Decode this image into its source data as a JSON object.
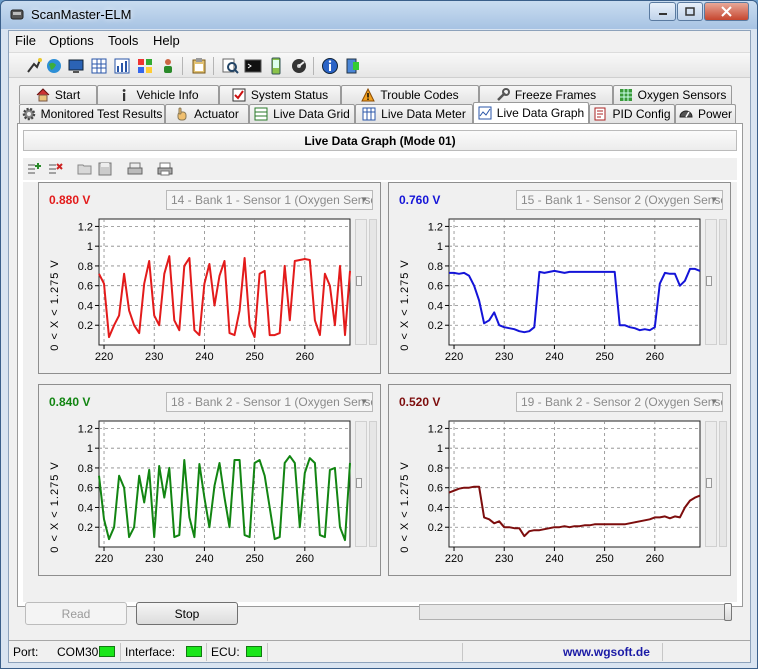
{
  "window": {
    "title": "ScanMaster-ELM"
  },
  "menu": [
    "File",
    "Options",
    "Tools",
    "Help"
  ],
  "tabs_row1": [
    {
      "label": "Start",
      "icon": "house-icon"
    },
    {
      "label": "Vehicle Info",
      "icon": "info-i-icon"
    },
    {
      "label": "System Status",
      "icon": "checkbox-icon"
    },
    {
      "label": "Trouble Codes",
      "icon": "warning-icon"
    },
    {
      "label": "Freeze Frames",
      "icon": "tools-icon"
    },
    {
      "label": "Oxygen Sensors",
      "icon": "grid-icon"
    }
  ],
  "tabs_row2": [
    {
      "label": "Monitored Test Results",
      "icon": "gear-icon"
    },
    {
      "label": "Actuator",
      "icon": "hand-icon"
    },
    {
      "label": "Live Data Grid",
      "icon": "grid-table-icon"
    },
    {
      "label": "Live Data Meter",
      "icon": "meter-icon"
    },
    {
      "label": "Live Data Graph",
      "icon": "graph-icon"
    },
    {
      "label": "PID Config",
      "icon": "config-icon"
    },
    {
      "label": "Power",
      "icon": "gauge-icon"
    }
  ],
  "panel": {
    "title": "Live Data Graph (Mode 01)"
  },
  "graphs": [
    {
      "value": "0.880 V",
      "color": "#e31b1b",
      "sensor": "14 - Bank 1 - Sensor 1 (Oxygen Senso",
      "ylabel": "0  < X <  1.275  V",
      "yticks": [
        "1.2",
        "1",
        "0.8",
        "0.6",
        "0.4",
        "0.2"
      ],
      "xticks": [
        "220",
        "230",
        "240",
        "250",
        "260"
      ]
    },
    {
      "value": "0.760 V",
      "color": "#1414d8",
      "sensor": "15 - Bank 1 - Sensor 2 (Oxygen Senso",
      "ylabel": "0  < X <  1.275  V",
      "yticks": [
        "1.2",
        "1",
        "0.8",
        "0.6",
        "0.4",
        "0.2"
      ],
      "xticks": [
        "220",
        "230",
        "240",
        "250",
        "260"
      ]
    },
    {
      "value": "0.840 V",
      "color": "#128512",
      "sensor": "18 - Bank 2 - Sensor 1 (Oxygen Senso",
      "ylabel": "0  < X <  1.275  V",
      "yticks": [
        "1.2",
        "1",
        "0.8",
        "0.6",
        "0.4",
        "0.2"
      ],
      "xticks": [
        "220",
        "230",
        "240",
        "250",
        "260"
      ]
    },
    {
      "value": "0.520 V",
      "color": "#7d0d0d",
      "sensor": "19 - Bank 2 - Sensor 2 (Oxygen Senso",
      "ylabel": "0  < X <  1.275  V",
      "yticks": [
        "1.2",
        "1",
        "0.8",
        "0.6",
        "0.4",
        "0.2"
      ],
      "xticks": [
        "220",
        "230",
        "240",
        "250",
        "260"
      ]
    }
  ],
  "chart_data": [
    {
      "type": "line",
      "x_start": 219,
      "x_step": 1,
      "ylim": [
        0,
        1.275
      ],
      "xlim": [
        219,
        269
      ],
      "series": [
        {
          "values": [
            0.72,
            0.62,
            0.08,
            0.2,
            0.3,
            0.72,
            0.35,
            0.2,
            0.12,
            0.62,
            0.85,
            0.3,
            0.2,
            0.72,
            0.9,
            0.25,
            0.15,
            0.8,
            0.88,
            0.15,
            0.1,
            0.62,
            0.82,
            0.4,
            0.7,
            0.85,
            0.12,
            0.1,
            0.35,
            0.88,
            0.2,
            0.08,
            0.72,
            0.75,
            0.1,
            0.1,
            0.12,
            0.8,
            0.25,
            0.85,
            0.86,
            0.87,
            0.86,
            0.25,
            0.1,
            0.72,
            0.6,
            0.2,
            0.8,
            0.1,
            0.75
          ]
        }
      ]
    },
    {
      "type": "line",
      "x_start": 219,
      "x_step": 1,
      "ylim": [
        0,
        1.275
      ],
      "xlim": [
        219,
        269
      ],
      "series": [
        {
          "values": [
            0.73,
            0.73,
            0.72,
            0.73,
            0.7,
            0.6,
            0.45,
            0.22,
            0.25,
            0.33,
            0.2,
            0.18,
            0.17,
            0.16,
            0.14,
            0.13,
            0.14,
            0.18,
            0.74,
            0.73,
            0.74,
            0.75,
            0.74,
            0.73,
            0.74,
            0.74,
            0.74,
            0.74,
            0.74,
            0.74,
            0.74,
            0.74,
            0.74,
            0.74,
            0.2,
            0.2,
            0.18,
            0.17,
            0.15,
            0.16,
            0.15,
            0.18,
            0.62,
            0.73,
            0.72,
            0.72,
            0.6,
            0.65,
            0.77,
            0.77,
            0.75
          ]
        }
      ]
    },
    {
      "type": "line",
      "x_start": 219,
      "x_step": 1,
      "ylim": [
        0,
        1.275
      ],
      "xlim": [
        219,
        269
      ],
      "series": [
        {
          "values": [
            0.72,
            0.28,
            0.08,
            0.2,
            0.72,
            0.6,
            0.1,
            0.2,
            0.72,
            0.45,
            0.78,
            0.1,
            0.82,
            0.5,
            0.8,
            0.1,
            0.12,
            0.88,
            0.3,
            0.1,
            0.84,
            0.5,
            0.2,
            0.62,
            0.85,
            0.5,
            0.2,
            0.88,
            0.88,
            0.12,
            0.1,
            0.85,
            0.88,
            0.72,
            0.4,
            0.08,
            0.1,
            0.85,
            0.92,
            0.85,
            0.2,
            0.75,
            0.9,
            0.85,
            0.12,
            0.1,
            0.78,
            0.8,
            0.2,
            0.07,
            0.85
          ]
        }
      ]
    },
    {
      "type": "line",
      "x_start": 219,
      "x_step": 1,
      "ylim": [
        0,
        1.275
      ],
      "xlim": [
        219,
        269
      ],
      "series": [
        {
          "values": [
            0.55,
            0.57,
            0.59,
            0.6,
            0.6,
            0.61,
            0.61,
            0.3,
            0.28,
            0.24,
            0.26,
            0.2,
            0.2,
            0.19,
            0.19,
            0.11,
            0.16,
            0.17,
            0.17,
            0.18,
            0.19,
            0.2,
            0.2,
            0.21,
            0.2,
            0.21,
            0.21,
            0.22,
            0.22,
            0.23,
            0.23,
            0.23,
            0.23,
            0.23,
            0.23,
            0.23,
            0.24,
            0.25,
            0.26,
            0.27,
            0.28,
            0.3,
            0.3,
            0.31,
            0.29,
            0.31,
            0.3,
            0.4,
            0.47,
            0.5,
            0.52
          ]
        }
      ]
    }
  ],
  "buttons": {
    "read": "Read",
    "stop": "Stop"
  },
  "status": {
    "port_label": "Port:",
    "port_value": "COM30",
    "interface_label": "Interface:",
    "ecu_label": "ECU:",
    "website": "www.wgsoft.de"
  }
}
